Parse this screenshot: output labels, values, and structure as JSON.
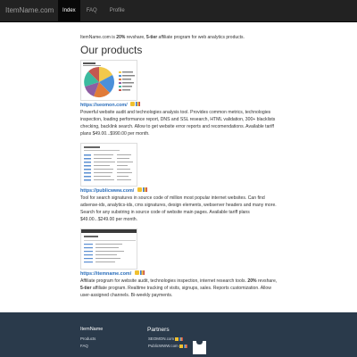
{
  "navbar": {
    "brand": "ItemName.com",
    "items": [
      {
        "label": "Index",
        "active": true
      },
      {
        "label": "FAQ",
        "active": false
      },
      {
        "label": "Profile",
        "active": false
      }
    ]
  },
  "intro": {
    "prefix": "ItemName.com is ",
    "revshare": "20%",
    "middle": " revshare, ",
    "tier": "5-tier",
    "suffix": " affiliate program for web analytics products."
  },
  "section_title": "Our products",
  "products": [
    {
      "link": "https://seomon.com/",
      "description": "Powerful website audit and technologies analysis tool. Provides common metrics, technologies inspection, loading performance report, DNS and SSL research, HTML validation, 300+ blacklists checking, backlink search. Allow to get website error reports and recomendations. Available tariff plans $49.00...$990.00 per month."
    },
    {
      "link": "https://publicwww.com/",
      "description": "Tool for search signatures in source code of million most popular internet websites. Can find adsense-ids, analytics-ids, cms signatures, design elements, webserver headers and many more. Search for any substring in source code of website main pages. Available tariff plans $49.00...$249.00 per month."
    },
    {
      "link": "https://itemname.com/",
      "desc_prefix": "Affiliate program for website audit, technologies inspection, internet research tools. ",
      "revshare": "20%",
      "desc_middle": " revshare, ",
      "tier": "5-tier",
      "desc_suffix": " affiliate program. Realtime tracking of visits, signups, sales. Reports customization. Allow user-assigned channels. Bi-weekly payments."
    }
  ],
  "footer": {
    "brand_title": "ItemName",
    "links": [
      "Products",
      "FAQ"
    ],
    "partners_title": "Partners",
    "partners": [
      "SEOMON.com",
      "PublicWWW.com"
    ]
  },
  "colors": {
    "navbar_bg": "#222222",
    "link": "#2a6ebb",
    "footer_bg": "#2a3a4b"
  },
  "icons": [
    "stats-icon",
    "chart-bar-icon",
    "product-logo-icon"
  ]
}
